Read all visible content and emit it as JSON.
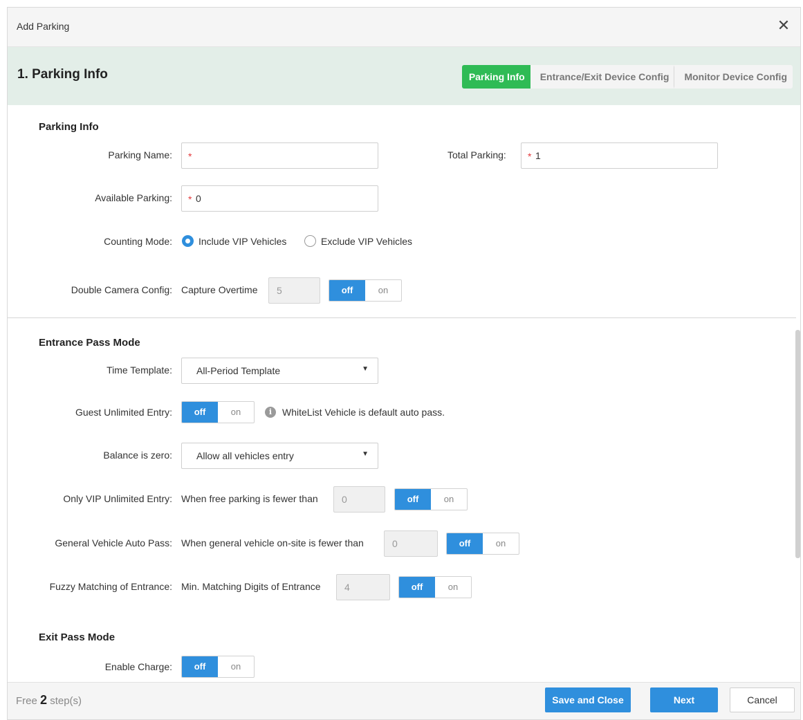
{
  "dialog": {
    "title": "Add Parking",
    "close_icon": "close-icon",
    "step_title": "1. Parking Info",
    "steps": [
      "Parking Info",
      "Entrance/Exit Device Config",
      "Monitor Device Config"
    ],
    "active_step": 0,
    "active_color": "#2fbb55"
  },
  "parking_info": {
    "heading": "Parking Info",
    "parking_name_label": "Parking Name:",
    "parking_name_value": "",
    "total_parking_label": "Total Parking:",
    "total_parking_value": "1",
    "available_parking_label": "Available Parking:",
    "available_parking_value": "0",
    "required_mark": "*",
    "counting_mode_label": "Counting Mode:",
    "counting_mode_options": [
      "Include VIP Vehicles",
      "Exclude VIP Vehicles"
    ],
    "counting_mode_selected": "Include VIP Vehicles",
    "double_camera_label": "Double Camera Config:",
    "capture_overtime_label": "Capture Overtime",
    "capture_overtime_value": "5"
  },
  "toggle": {
    "off_label": "off",
    "on_label": "on",
    "accent": "#2f8fdd"
  },
  "entrance": {
    "heading": "Entrance Pass Mode",
    "time_template_label": "Time Template:",
    "time_template_value": "All-Period Template",
    "guest_unlimited_label": "Guest Unlimited Entry:",
    "whitelist_note": "WhiteList Vehicle is default auto pass.",
    "info_icon": "info-icon",
    "balance_zero_label": "Balance is zero:",
    "balance_zero_value": "Allow all vehicles entry",
    "vip_unlimited_label": "Only VIP Unlimited Entry:",
    "vip_unlimited_text": "When free parking is fewer than",
    "vip_unlimited_value": "0",
    "general_auto_label": "General Vehicle Auto Pass:",
    "general_auto_text": "When general vehicle on-site is fewer than",
    "general_auto_value": "0",
    "fuzzy_label": "Fuzzy Matching of Entrance:",
    "fuzzy_text": "Min. Matching Digits of Entrance",
    "fuzzy_value": "4"
  },
  "exit": {
    "heading": "Exit Pass Mode",
    "enable_charge_label": "Enable Charge:"
  },
  "footer": {
    "free_prefix": "Free",
    "free_count": "2",
    "free_suffix": "step(s)",
    "save_close": "Save and Close",
    "next": "Next",
    "cancel": "Cancel"
  }
}
